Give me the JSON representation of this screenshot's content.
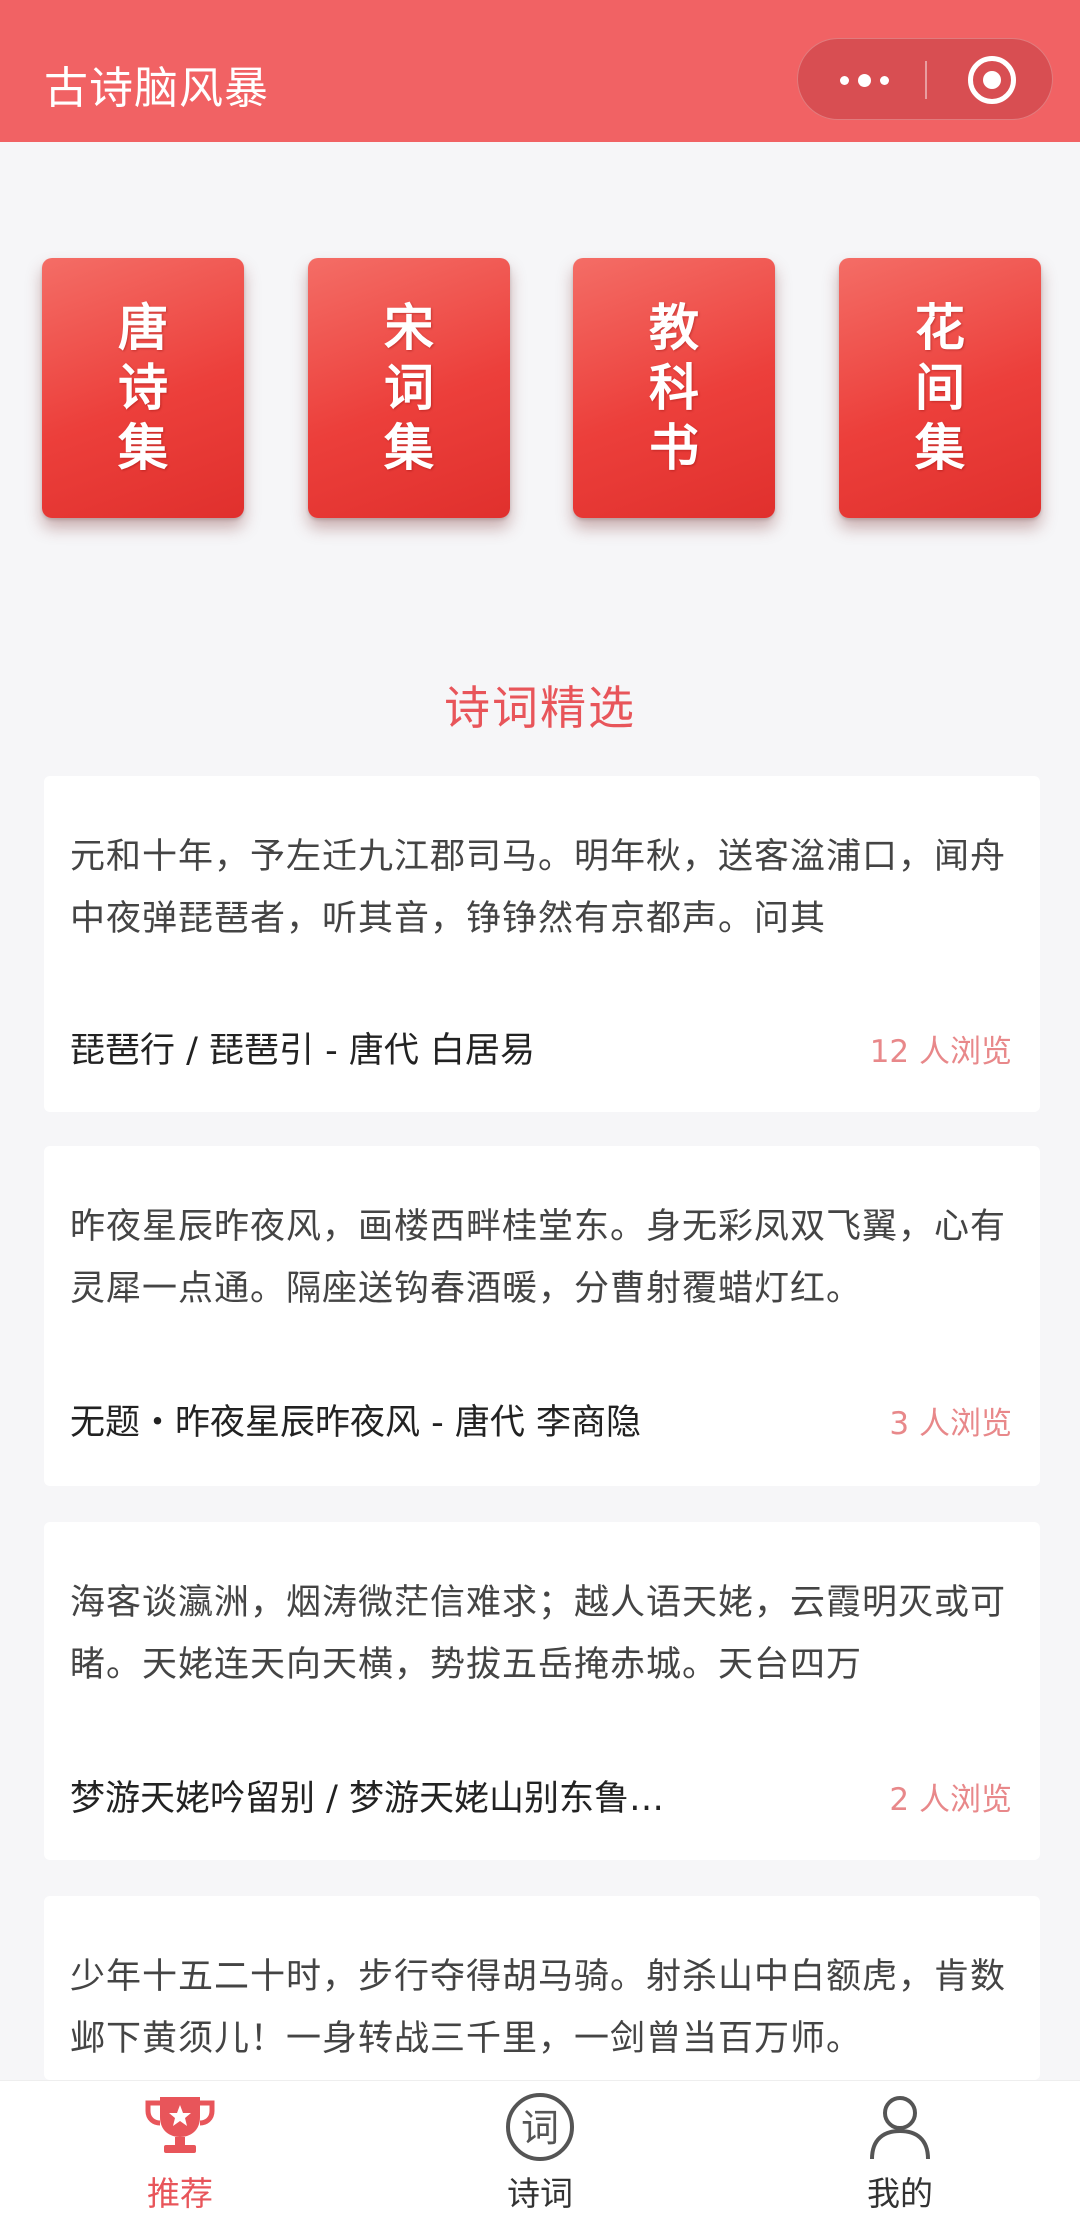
{
  "header": {
    "title": "古诗脑风暴"
  },
  "categories": [
    {
      "label": "唐诗集"
    },
    {
      "label": "宋词集"
    },
    {
      "label": "教科书"
    },
    {
      "label": "花间集"
    }
  ],
  "section": {
    "title": "诗词精选"
  },
  "poems": [
    {
      "excerpt": "元和十年，予左迁九江郡司马。明年秋，送客湓浦口，闻舟中夜弹琵琶者，听其音，铮铮然有京都声。问其",
      "title": "琵琶行 / 琵琶引 - 唐代 白居易",
      "views": "12 人浏览"
    },
    {
      "excerpt": "昨夜星辰昨夜风，画楼西畔桂堂东。身无彩凤双飞翼，心有灵犀一点通。隔座送钩春酒暖，分曹射覆蜡灯红。",
      "title": "无题・昨夜星辰昨夜风 - 唐代 李商隐",
      "views": "3 人浏览"
    },
    {
      "excerpt": "海客谈瀛洲，烟涛微茫信难求；越人语天姥，云霞明灭或可睹。天姥连天向天横，势拔五岳掩赤城。天台四万",
      "title": "梦游天姥吟留别 / 梦游天姥山别东鲁…",
      "views": "2 人浏览"
    },
    {
      "excerpt": "少年十五二十时，步行夺得胡马骑。射杀山中白额虎，肯数邺下黄须儿！一身转战三千里，一剑曾当百万师。",
      "title": "",
      "views": ""
    }
  ],
  "tabs": [
    {
      "label": "推荐",
      "icon": "trophy-icon",
      "active": true
    },
    {
      "label": "诗词",
      "icon": "ci-character-icon",
      "active": false
    },
    {
      "label": "我的",
      "icon": "user-icon",
      "active": false
    }
  ],
  "colors": {
    "brand": "#f16264",
    "accent": "#e8555a",
    "background": "#f6f6f8"
  }
}
